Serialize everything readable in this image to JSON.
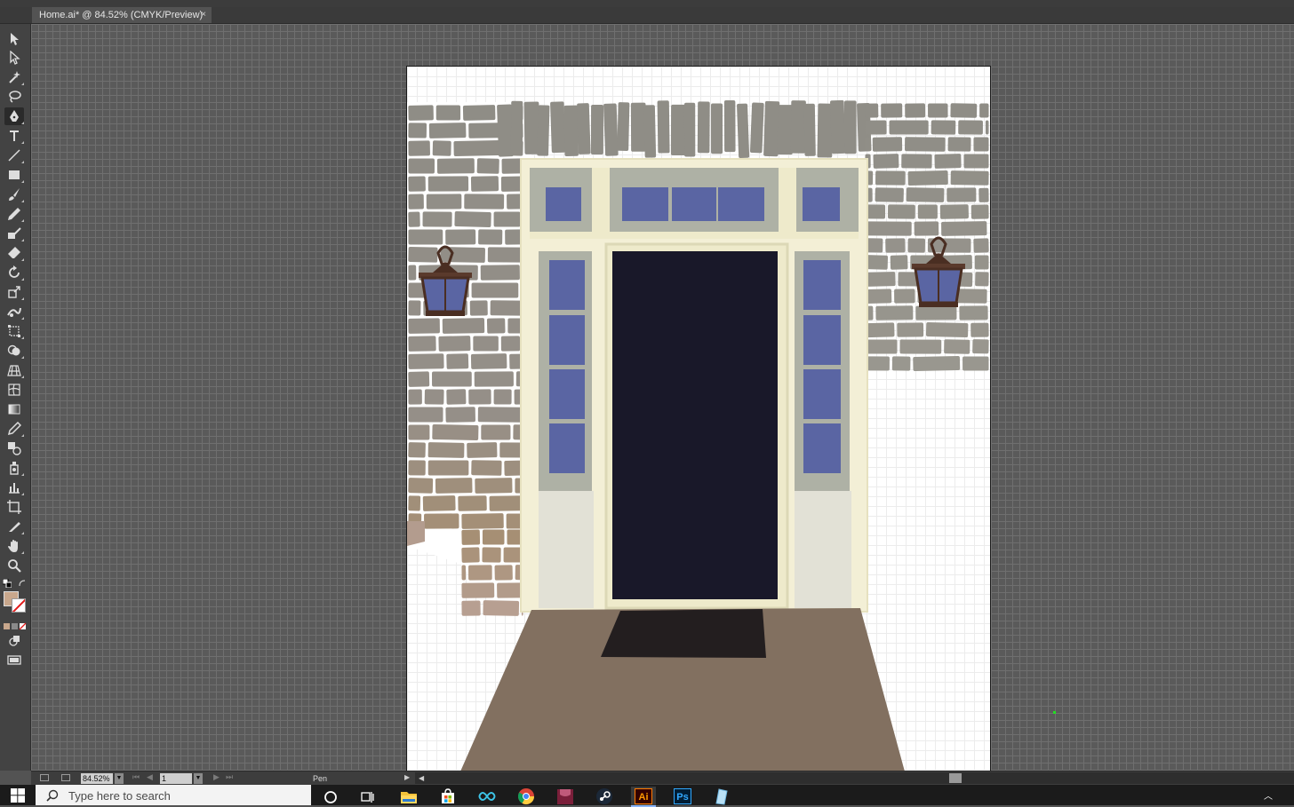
{
  "app": {
    "name": "Adobe Illustrator"
  },
  "document_tab": {
    "title": "Home.ai* @ 84.52% (CMYK/Preview)",
    "close_glyph": "×"
  },
  "toolbar": {
    "tools": [
      {
        "name": "selection-tool-icon",
        "active": false
      },
      {
        "name": "direct-selection-tool-icon",
        "active": false
      },
      {
        "name": "magic-wand-tool-icon",
        "active": false
      },
      {
        "name": "lasso-tool-icon",
        "active": false
      },
      {
        "name": "pen-tool-icon",
        "active": true
      },
      {
        "name": "type-tool-icon",
        "active": false
      },
      {
        "name": "line-segment-tool-icon",
        "active": false
      },
      {
        "name": "rectangle-tool-icon",
        "active": false
      },
      {
        "name": "paintbrush-tool-icon",
        "active": false
      },
      {
        "name": "pencil-tool-icon",
        "active": false
      },
      {
        "name": "shaper-tool-icon",
        "active": false
      },
      {
        "name": "eraser-tool-icon",
        "active": false
      },
      {
        "name": "rotate-tool-icon",
        "active": false
      },
      {
        "name": "scale-tool-icon",
        "active": false
      },
      {
        "name": "warp-tool-icon",
        "active": false
      },
      {
        "name": "free-transform-tool-icon",
        "active": false
      },
      {
        "name": "shape-builder-tool-icon",
        "active": false
      },
      {
        "name": "perspective-grid-tool-icon",
        "active": false
      },
      {
        "name": "mesh-tool-icon",
        "active": false
      },
      {
        "name": "gradient-tool-icon",
        "active": false
      },
      {
        "name": "eyedropper-tool-icon",
        "active": false
      },
      {
        "name": "blend-tool-icon",
        "active": false
      },
      {
        "name": "symbol-sprayer-tool-icon",
        "active": false
      },
      {
        "name": "column-graph-tool-icon",
        "active": false
      },
      {
        "name": "artboard-tool-icon",
        "active": false
      },
      {
        "name": "slice-tool-icon",
        "active": false
      },
      {
        "name": "hand-tool-icon",
        "active": false
      },
      {
        "name": "zoom-tool-icon",
        "active": false
      }
    ],
    "fill_color": "#c8a78c",
    "stroke": "none"
  },
  "statusbar": {
    "zoom": "84.52%",
    "artboard_number": "1",
    "current_tool": "Pen"
  },
  "artwork": {
    "description_colors": {
      "stone_gray": "#8f8d86",
      "stone_warm": "#a68f74",
      "mortar": "#ffffff",
      "door_trim": "#eeeacb",
      "door": "#191829",
      "glass": "#5a65a3",
      "porch": "#827060",
      "doormat": "#231e1f",
      "lantern": "#4a2e22"
    }
  },
  "taskbar": {
    "search_placeholder": "Type here to search",
    "apps": [
      {
        "name": "cortana-icon"
      },
      {
        "name": "task-view-icon"
      },
      {
        "name": "file-explorer-icon"
      },
      {
        "name": "store-icon"
      },
      {
        "name": "infinity-app-icon"
      },
      {
        "name": "chrome-icon"
      },
      {
        "name": "app-icon-maroon"
      },
      {
        "name": "steam-icon"
      },
      {
        "name": "illustrator-icon",
        "label": "Ai"
      },
      {
        "name": "photoshop-icon",
        "label": "Ps"
      },
      {
        "name": "notes-app-icon"
      }
    ]
  }
}
